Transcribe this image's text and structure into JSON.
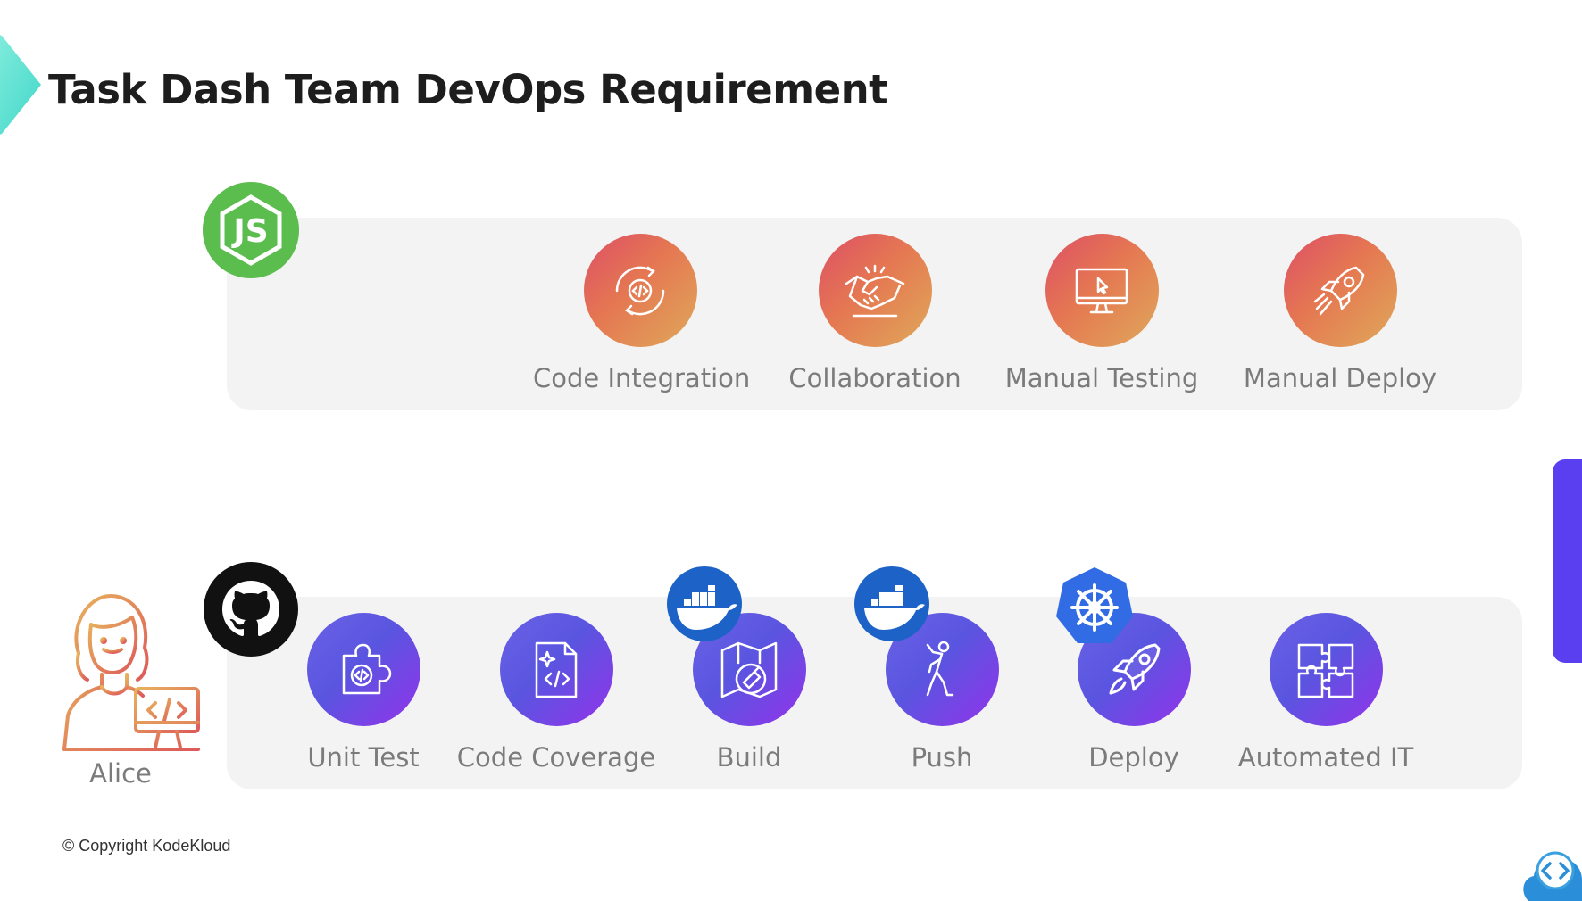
{
  "title": "Task Dash Team DevOps Requirement",
  "manual_pipeline": {
    "badge_icon": "nodejs-icon",
    "steps": [
      {
        "label": "Code Integration",
        "icon": "code-integration-icon"
      },
      {
        "label": "Collaboration",
        "icon": "handshake-icon"
      },
      {
        "label": "Manual Testing",
        "icon": "monitor-cursor-icon"
      },
      {
        "label": "Manual Deploy",
        "icon": "rocket-icon"
      }
    ]
  },
  "automated_pipeline": {
    "badge_icon": "github-icon",
    "steps": [
      {
        "label": "Unit Test",
        "icon": "puzzle-code-icon"
      },
      {
        "label": "Code Coverage",
        "icon": "code-file-icon"
      },
      {
        "label": "Build",
        "icon": "build-map-icon",
        "badge": "docker-icon"
      },
      {
        "label": "Push",
        "icon": "pushing-person-icon",
        "badge": "docker-icon"
      },
      {
        "label": "Deploy",
        "icon": "rocket-icon",
        "badge": "kubernetes-icon"
      },
      {
        "label": "Automated IT",
        "icon": "puzzle-pieces-icon"
      }
    ]
  },
  "persona": {
    "name": "Alice",
    "icon": "developer-avatar-icon"
  },
  "footer": {
    "copyright": "© Copyright KodeKloud"
  },
  "colors": {
    "manual_gradient": [
      "#dd4f66",
      "#dfa95a"
    ],
    "automated_gradient": [
      "#6a62e6",
      "#9333ea"
    ],
    "nodejs_green": "#6cc24a",
    "docker_blue": "#1d63c7",
    "kubernetes_blue": "#326ce5",
    "panel_bg": "#f3f3f3"
  }
}
